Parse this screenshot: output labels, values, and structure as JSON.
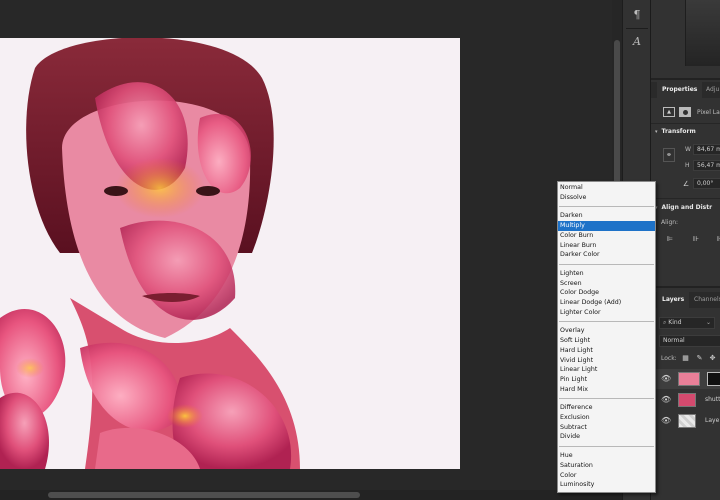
{
  "toolstrip": {
    "paragraph_glyph": "¶",
    "character_glyph": "A"
  },
  "properties_panel": {
    "tabs": [
      "Properties",
      "Adju"
    ],
    "layer_type": "Pixel Lay",
    "transform_title": "Transform",
    "w_label": "W",
    "w_value": "84,67 m",
    "h_label": "H",
    "h_value": "56,47 m",
    "angle_value": "0,00°",
    "align_title": "Align and Distr",
    "align_label": "Align:"
  },
  "layers_panel": {
    "tabs": [
      "Layers",
      "Channels"
    ],
    "filter_kind": "Kind",
    "blend_mode": "Normal",
    "lock_label": "Lock:",
    "layers": [
      {
        "name": "",
        "selected": true
      },
      {
        "name": "shutt",
        "selected": false
      },
      {
        "name": "Laye",
        "selected": false
      }
    ]
  },
  "blend_menu": {
    "groups": [
      [
        "Normal",
        "Dissolve"
      ],
      [
        "Darken",
        "Multiply",
        "Color Burn",
        "Linear Burn",
        "Darker Color"
      ],
      [
        "Lighten",
        "Screen",
        "Color Dodge",
        "Linear Dodge (Add)",
        "Lighter Color"
      ],
      [
        "Overlay",
        "Soft Light",
        "Hard Light",
        "Vivid Light",
        "Linear Light",
        "Pin Light",
        "Hard Mix"
      ],
      [
        "Difference",
        "Exclusion",
        "Subtract",
        "Divide"
      ],
      [
        "Hue",
        "Saturation",
        "Color",
        "Luminosity"
      ]
    ],
    "highlighted": "Multiply"
  },
  "colors": {
    "menu_highlight": "#1e72c8",
    "panel_bg": "#323232",
    "canvas_bg": "#282828"
  },
  "icons": {
    "eye": "eye-icon",
    "link": "link-chain-icon",
    "pixel_layer": "image-icon",
    "mask": "mask-icon"
  }
}
